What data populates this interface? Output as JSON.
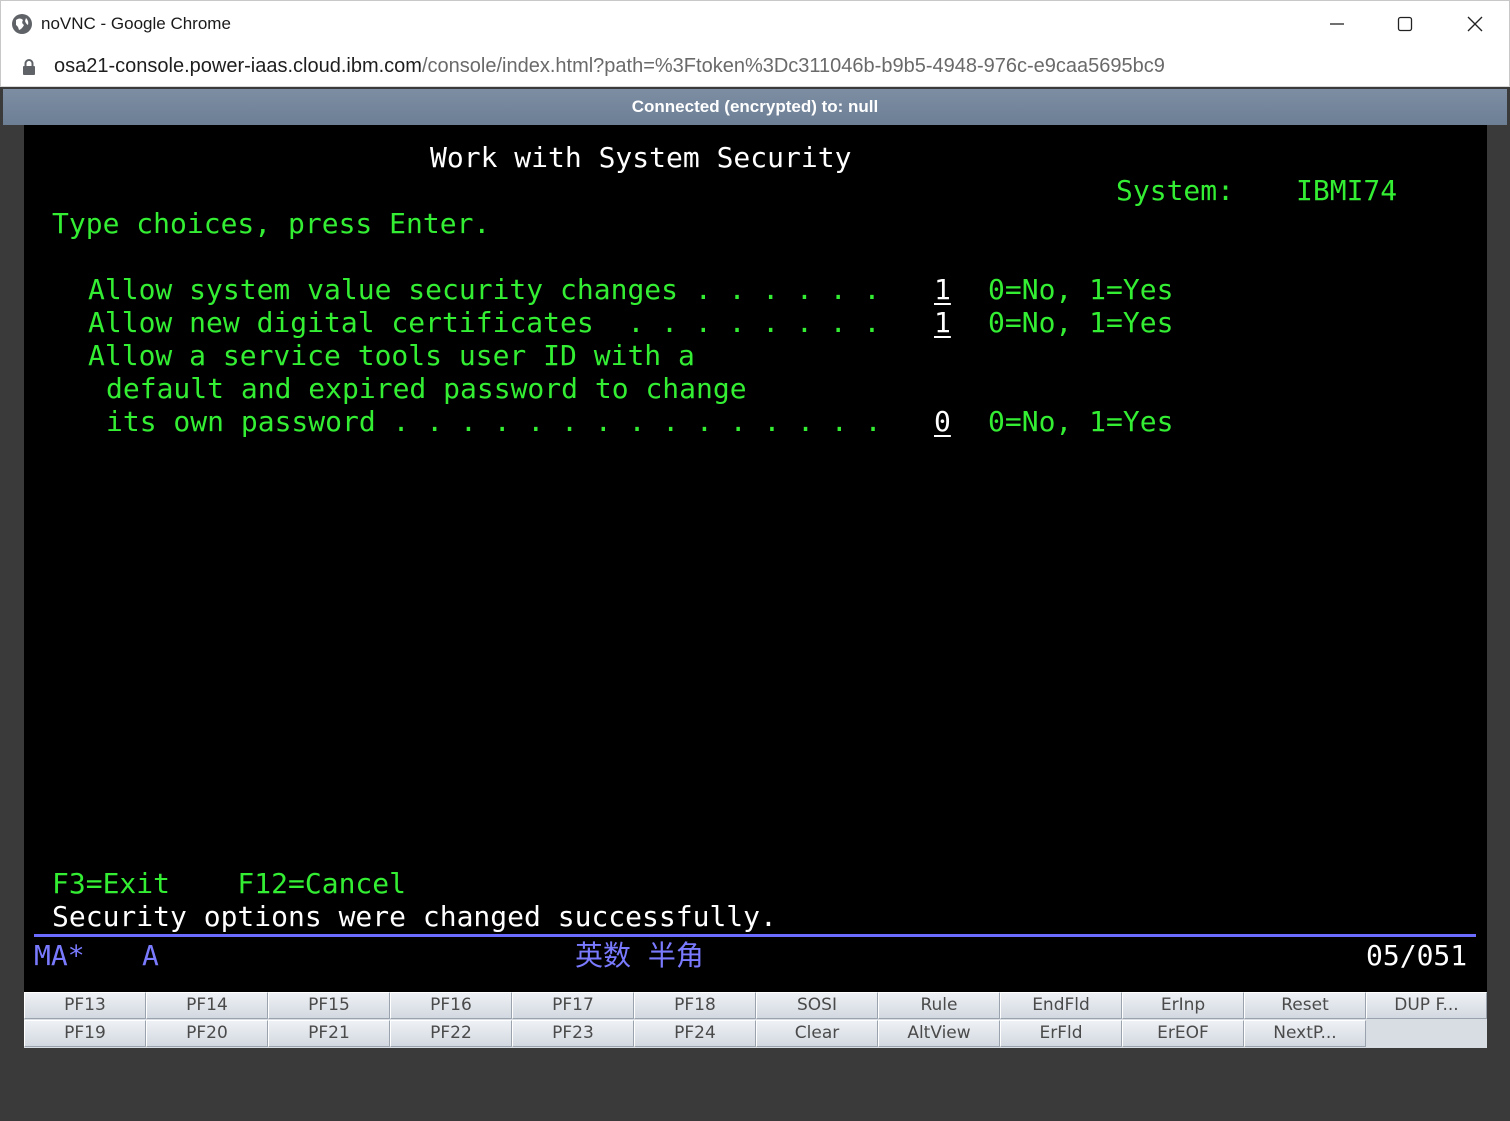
{
  "window": {
    "title": "noVNC - Google Chrome",
    "url_host": "osa21-console.power-iaas.cloud.ibm.com",
    "url_path": "/console/index.html?path=%3Ftoken%3Dc311046b-b9b5-4948-976c-e9caa5695bc9"
  },
  "novnc": {
    "status": "Connected (encrypted) to: null"
  },
  "screen": {
    "title": "Work with System Security",
    "system_label": "System:",
    "system_name": "IBMI74",
    "instructions": "Type choices, press Enter.",
    "options": [
      {
        "line1": "Allow system value security changes . . . . . .",
        "value": "1",
        "hint": "0=No, 1=Yes"
      },
      {
        "line1": "Allow new digital certificates  . . . . . . . .",
        "value": "1",
        "hint": "0=No, 1=Yes"
      },
      {
        "line1": "Allow a service tools user ID with a",
        "line2": "default and expired password to change",
        "line3": "its own password . . . . . . . . . . . . . . .",
        "value": "0",
        "hint": "0=No, 1=Yes"
      }
    ],
    "fkeys": "F3=Exit    F12=Cancel",
    "message": "Security options were changed successfully.",
    "status_ma": "MA*",
    "status_a": "A",
    "status_ime": "英数 半角",
    "cursor_pos": "05/051"
  },
  "pf_keys": {
    "row1": [
      "PF13",
      "PF14",
      "PF15",
      "PF16",
      "PF17",
      "PF18",
      "SOSI",
      "Rule",
      "EndFld",
      "ErInp",
      "Reset",
      "DUP F..."
    ],
    "row2": [
      "PF19",
      "PF20",
      "PF21",
      "PF22",
      "PF23",
      "PF24",
      "Clear",
      "AltView",
      "ErFld",
      "ErEOF",
      "NextP..."
    ]
  }
}
